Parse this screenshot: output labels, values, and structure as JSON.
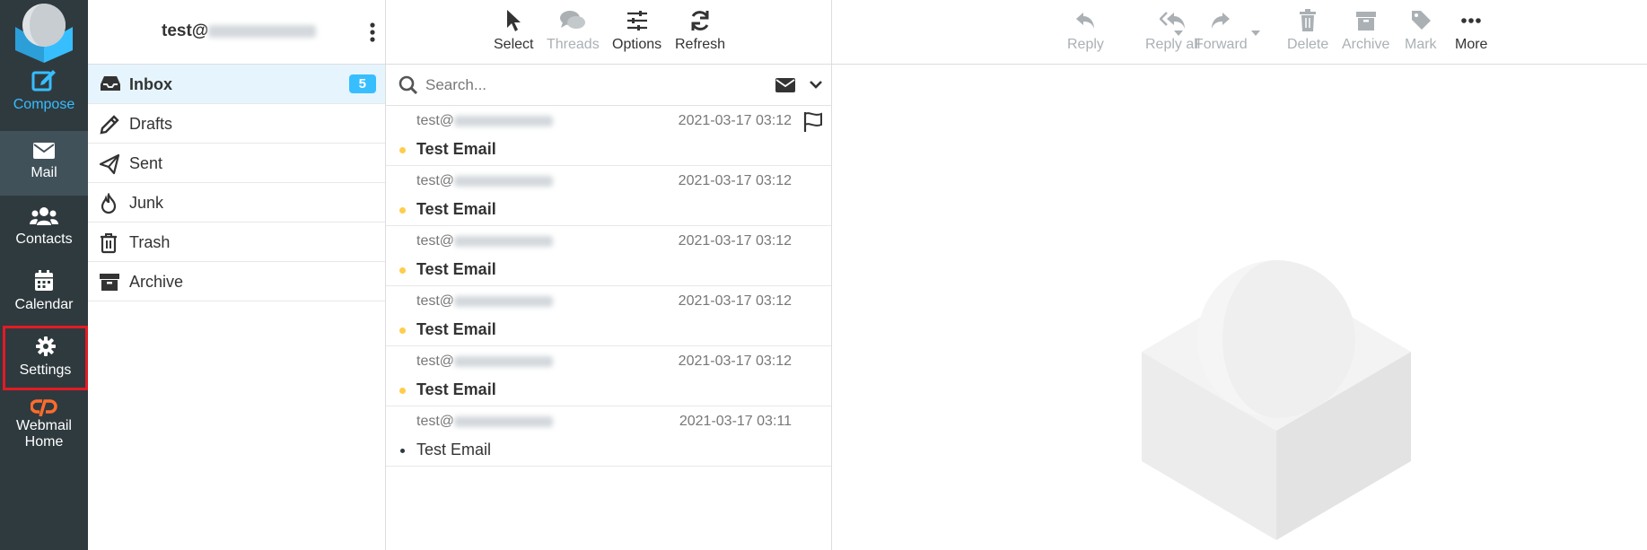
{
  "nav": {
    "compose": "Compose",
    "mail": "Mail",
    "contacts": "Contacts",
    "calendar": "Calendar",
    "settings": "Settings",
    "webmail_home_line1": "Webmail",
    "webmail_home_line2": "Home"
  },
  "account": {
    "prefix": "test@"
  },
  "folders": [
    {
      "name": "Inbox",
      "count": "5"
    },
    {
      "name": "Drafts"
    },
    {
      "name": "Sent"
    },
    {
      "name": "Junk"
    },
    {
      "name": "Trash"
    },
    {
      "name": "Archive"
    }
  ],
  "list_toolbar": {
    "select": "Select",
    "threads": "Threads",
    "options": "Options",
    "refresh": "Refresh"
  },
  "search": {
    "placeholder": "Search..."
  },
  "messages": [
    {
      "from": "test@",
      "date": "2021-03-17 03:12",
      "subject": "Test Email"
    },
    {
      "from": "test@",
      "date": "2021-03-17 03:12",
      "subject": "Test Email"
    },
    {
      "from": "test@",
      "date": "2021-03-17 03:12",
      "subject": "Test Email"
    },
    {
      "from": "test@",
      "date": "2021-03-17 03:12",
      "subject": "Test Email"
    },
    {
      "from": "test@",
      "date": "2021-03-17 03:12",
      "subject": "Test Email"
    },
    {
      "from": "test@",
      "date": "2021-03-17 03:11",
      "subject": "Test Email"
    }
  ],
  "preview_toolbar": {
    "reply": "Reply",
    "reply_all": "Reply all",
    "forward": "Forward",
    "delete": "Delete",
    "archive": "Archive",
    "mark": "Mark",
    "more": "More"
  },
  "colors": {
    "rail_bg": "#2f3a3f",
    "accent": "#37beff",
    "highlight_box": "#e31b23",
    "unread_dot": "#ffcd4b"
  }
}
